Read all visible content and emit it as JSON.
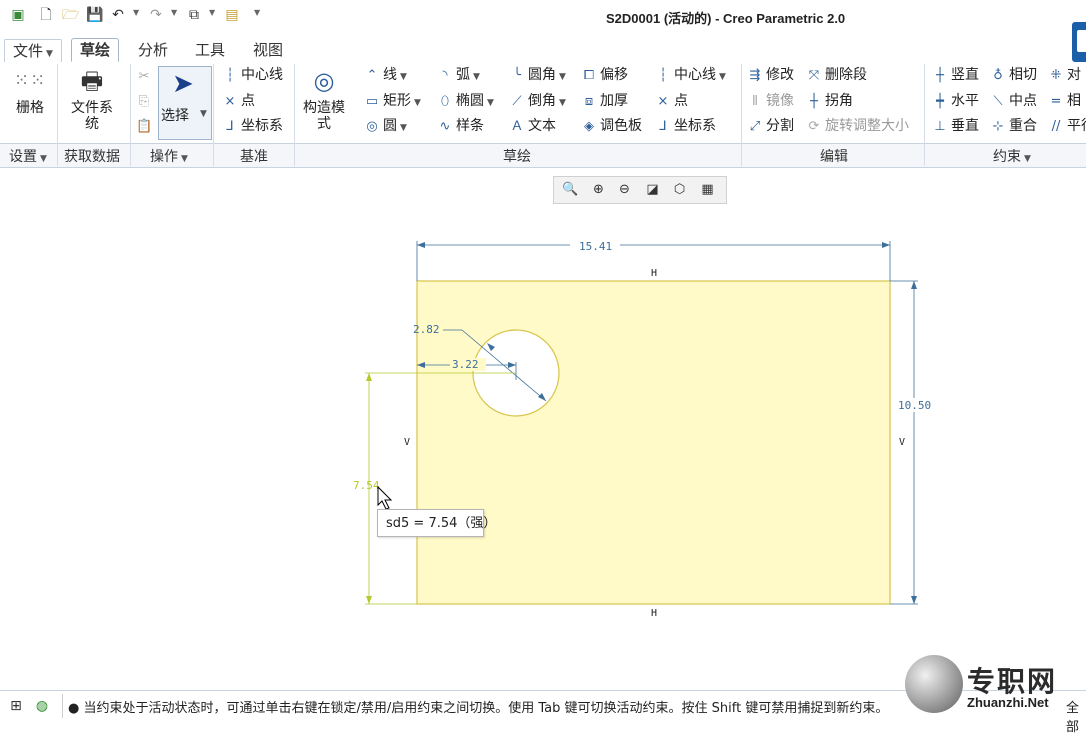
{
  "app": {
    "title": "S2D0001 (活动的) - Creo Parametric 2.0"
  },
  "tabs": [
    {
      "label": "文件",
      "active": false
    },
    {
      "label": "草绘",
      "active": true
    },
    {
      "label": "分析",
      "active": false
    },
    {
      "label": "工具",
      "active": false
    },
    {
      "label": "视图",
      "active": false
    }
  ],
  "ribbon": {
    "setup": {
      "grid_label": "栅格"
    },
    "get_data": {
      "file_system_label": "文件系统"
    },
    "operations": {
      "select_label": "选择"
    },
    "datum": {
      "centerline_label": "中心线",
      "point_label": "点",
      "csys_label": "坐标系"
    },
    "construction_mode_label": "构造模式",
    "sketch": {
      "line_label": "线",
      "rectangle_label": "矩形",
      "circle_label": "圆",
      "arc_label": "弧",
      "ellipse_label": "椭圆",
      "spline_label": "样条",
      "fillet_label": "圆角",
      "chamfer_label": "倒角",
      "text_label": "文本",
      "offset_label": "偏移",
      "thicken_label": "加厚",
      "palette_label": "调色板",
      "centerline_label": "中心线",
      "point_label": "点",
      "csys_label": "坐标系"
    },
    "editing": {
      "modify_label": "修改",
      "delete_segment_label": "删除段",
      "mirror_label": "镜像",
      "corner_label": "拐角",
      "divide_label": "分割",
      "rotate_resize_label": "旋转调整大小"
    },
    "constrain": {
      "vertical_label": "竖直",
      "tangent_label": "相切",
      "symmetric_label": "对",
      "horizontal_label": "水平",
      "midpoint_label": "中点",
      "equal_label": "相",
      "perpendicular_label": "垂直",
      "coincident_label": "重合",
      "parallel_label": "平行"
    },
    "groups": {
      "setup": "设置",
      "get_data": "获取数据",
      "operations": "操作",
      "datum": "基准",
      "sketch": "草绘",
      "editing": "编辑",
      "constrain": "约束"
    }
  },
  "sketch": {
    "dimensions": {
      "width": "15.41",
      "height": "10.50",
      "diameter": "2.82",
      "hole_x": "3.22",
      "hole_y": "7.54"
    },
    "constraint_marks": {
      "horizontal": "H",
      "vertical": "V"
    },
    "tooltip": "sd5 = 7.54（强）"
  },
  "status": {
    "message": "● 当约束处于活动状态时，可通过单击右键在锁定/禁用/启用约束之间切换。使用 Tab 键可切换活动约束。按住 Shift 键可禁用捕捉到新约束。",
    "right_text": "全部"
  },
  "watermark": {
    "text": "专职网",
    "subtext": "Zhuanzhi.Net"
  },
  "colors": {
    "sketch_fill": "#fffac8",
    "sketch_edge": "#d7c44a",
    "dimension_blue": "#3d6f9a",
    "dimension_active": "#b5c92c"
  }
}
